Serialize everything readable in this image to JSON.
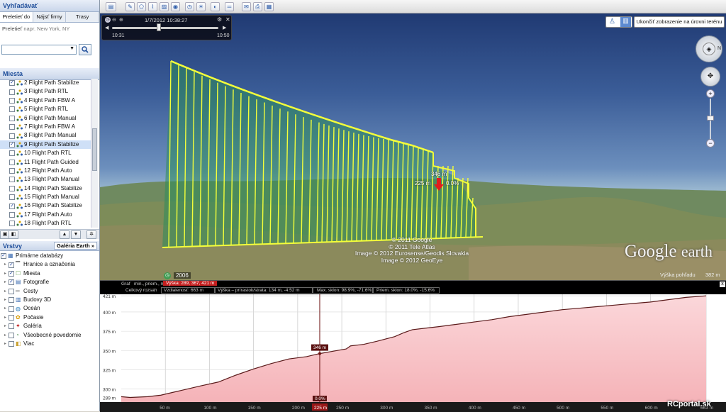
{
  "search_panel": {
    "title": "Vyhľadávať",
    "tabs": [
      "Preletieť do",
      "Nájsť firmy",
      "Trasy"
    ],
    "fly_label": "Preletieť",
    "fly_hint": "napr. New York, NY"
  },
  "places": {
    "title": "Miesta",
    "items": [
      {
        "label": "2 Flight Path Stabilize",
        "checked": true,
        "selected": false
      },
      {
        "label": "3 Flight Path RTL",
        "checked": false,
        "selected": false
      },
      {
        "label": "4 Flight Path FBW A",
        "checked": false,
        "selected": false
      },
      {
        "label": "5 Flight Path RTL",
        "checked": false,
        "selected": false
      },
      {
        "label": "6 Flight Path Manual",
        "checked": false,
        "selected": false
      },
      {
        "label": "7 Flight Path FBW A",
        "checked": false,
        "selected": false
      },
      {
        "label": "8 Flight Path Manual",
        "checked": false,
        "selected": false
      },
      {
        "label": "9 Flight Path Stabilize",
        "checked": true,
        "selected": true
      },
      {
        "label": "10 Flight Path RTL",
        "checked": false,
        "selected": false
      },
      {
        "label": "11 Flight Path Guided",
        "checked": false,
        "selected": false
      },
      {
        "label": "12 Flight Path Auto",
        "checked": false,
        "selected": false
      },
      {
        "label": "13 Flight Path Manual",
        "checked": false,
        "selected": false
      },
      {
        "label": "14 Flight Path Stabilize",
        "checked": false,
        "selected": false
      },
      {
        "label": "15 Flight Path Manual",
        "checked": false,
        "selected": false
      },
      {
        "label": "16 Flight Path Stabilize",
        "checked": true,
        "selected": false
      },
      {
        "label": "17 Flight Path Auto",
        "checked": false,
        "selected": false
      },
      {
        "label": "18 Flight Path RTL",
        "checked": false,
        "selected": false
      }
    ]
  },
  "layers": {
    "title": "Vrstvy",
    "gallery_button": "Galéria Earth",
    "gallery_arrow": "»",
    "items": [
      {
        "label": "Primárne databázy",
        "checked": true,
        "indent": 0
      },
      {
        "label": "Hranice a označenia",
        "checked": true,
        "indent": 1
      },
      {
        "label": "Miesta",
        "checked": true,
        "indent": 1
      },
      {
        "label": "Fotografie",
        "checked": true,
        "indent": 1
      },
      {
        "label": "Cesty",
        "checked": false,
        "indent": 1
      },
      {
        "label": "Budovy 3D",
        "checked": false,
        "indent": 1
      },
      {
        "label": "Oceán",
        "checked": false,
        "indent": 1
      },
      {
        "label": "Počasie",
        "checked": false,
        "indent": 1
      },
      {
        "label": "Galéria",
        "checked": false,
        "indent": 1
      },
      {
        "label": "Všeobecné povedomie",
        "checked": false,
        "indent": 1
      },
      {
        "label": "Viac",
        "checked": false,
        "indent": 1
      }
    ]
  },
  "time_slider": {
    "current": "1/7/2012  10:38:27",
    "start": "10:31",
    "end": "10:50",
    "position": 0.44
  },
  "exit_button": "Ukončiť zobrazenie na úrovni terénu",
  "view": {
    "marker_alt": "346 m",
    "marker_dist": "225 m",
    "marker_grade": "0.0%",
    "attribution": [
      "© 2011 Google",
      "© 2011 Tele Atlas",
      "Image © 2012 Eurosense/Geodis Slovakia",
      "Image © 2012 GeoEye"
    ],
    "logo_a": "Google",
    "logo_b": "earth",
    "year": "2006",
    "eye_alt_label": "Výška pohľadu",
    "eye_alt_value": "382 m"
  },
  "profile": {
    "graph_label": "Graf",
    "min_label": "min., priem., max",
    "vyska_text": "Výška: 289, 367, 421 m",
    "total_label": "Celkový rozsah",
    "distance_text": "Vzdialenosť: 663 m",
    "gain_text": "Výška – prírastok/strata: 134 m, -4.52 m",
    "max_slope_text": "Max. sklon: 98.9%, -71.6%",
    "avg_slope_text": "Priem. sklon: 18.0%, -15.6%",
    "cursor_alt": "346 m",
    "cursor_grade": "0.0%",
    "cursor_dist": "225 m",
    "watermark": "RCportal.sk",
    "close": "x"
  },
  "chart_data": {
    "type": "area",
    "title": "",
    "xlabel": "",
    "ylabel": "",
    "xlim": [
      0,
      663
    ],
    "ylim": [
      283,
      423
    ],
    "y_ticks": [
      "421 m",
      "400 m",
      "375 m",
      "350 m",
      "325 m",
      "300 m",
      "289 m"
    ],
    "y_tick_values": [
      421,
      400,
      375,
      350,
      325,
      300,
      289
    ],
    "x_ticks": [
      "50 m",
      "100 m",
      "150 m",
      "200 m",
      "250 m",
      "300 m",
      "350 m",
      "400 m",
      "450 m",
      "500 m",
      "550 m",
      "600 m",
      "663 m"
    ],
    "x_tick_values": [
      50,
      100,
      150,
      200,
      250,
      300,
      350,
      400,
      450,
      500,
      550,
      600,
      663
    ],
    "series": [
      {
        "x": [
          0,
          10,
          30,
          45,
          60,
          75,
          90,
          110,
          130,
          150,
          170,
          190,
          210,
          225,
          240,
          255,
          260,
          275,
          290,
          300,
          310,
          320,
          330,
          345,
          360,
          380,
          400,
          420,
          440,
          460,
          480,
          500,
          520,
          540,
          560,
          580,
          600,
          620,
          640,
          663
        ],
        "y": [
          290,
          289,
          290,
          292,
          296,
          300,
          304,
          309,
          318,
          326,
          333,
          339,
          342,
          346,
          349,
          352,
          356,
          358,
          362,
          365,
          368,
          373,
          377,
          379,
          381,
          384,
          387,
          390,
          394,
          397,
          400,
          403,
          405,
          407,
          409,
          411,
          413,
          416,
          419,
          421
        ]
      }
    ],
    "cursor_x": 225,
    "fill_color": "#f5b3b8",
    "line_color": "#5a1a1a",
    "grid": true
  }
}
